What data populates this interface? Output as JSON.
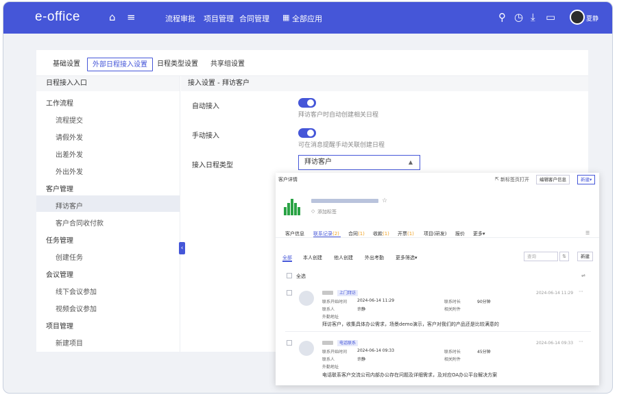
{
  "app": {
    "logo": "e-office",
    "nav": [
      "流程审批",
      "项目管理",
      "合同管理"
    ],
    "all_apps": "全部应用",
    "user": "夏静"
  },
  "tabs": [
    "基础设置",
    "外部日程接入设置",
    "日程类型设置",
    "共享组设置"
  ],
  "left_panel": {
    "header": "日程接入入口",
    "groups": [
      {
        "title": "工作流程",
        "items": [
          "流程提交",
          "请假外发",
          "出差外发",
          "外出外发"
        ]
      },
      {
        "title": "客户管理",
        "items": [
          "拜访客户",
          "客户合同收付款"
        ]
      },
      {
        "title": "任务管理",
        "items": [
          "创建任务"
        ]
      },
      {
        "title": "会议管理",
        "items": [
          "线下会议参加",
          "视频会议参加"
        ]
      },
      {
        "title": "项目管理",
        "items": [
          "新建项目"
        ]
      }
    ]
  },
  "settings": {
    "header": "接入设置 - 拜访客户",
    "auto_label": "自动接入",
    "auto_desc": "拜访客户时自动创建相关日程",
    "manual_label": "手动接入",
    "manual_desc": "可在消息提醒手动关联创建日程",
    "type_label": "接入日程类型",
    "type_value": "拜访客户"
  },
  "popup": {
    "title": "客户详情",
    "open_new_tab": "新标签页打开",
    "edit_btn": "编辑客户信息",
    "new_btn": "新建",
    "add_tag": "添加标签",
    "tabs": [
      "客户信息",
      "联系记录",
      "合同",
      "收款",
      "开票",
      "项目(研发)",
      "报价",
      "更多"
    ],
    "tab_counts": {
      "contact": "(2)",
      "contract": "(1)",
      "receipt": "(1)",
      "invoice": "(1)"
    },
    "subtabs": [
      "全部",
      "本人创建",
      "他人创建",
      "外出考勤",
      "更多筛选"
    ],
    "search_placeholder": "查询",
    "new_record": "新建",
    "select_all": "全选",
    "records": [
      {
        "tag": "上门拜访",
        "start_label": "联系开始时间",
        "start_value": "2024-06-14 11:29",
        "person_label": "联系人",
        "person_value": "许静",
        "addr_label": "外勤地址",
        "dur_label": "联系时长",
        "dur_value": "90分钟",
        "attach_label": "相关附件",
        "content": "拜访客户，收集具体办公需求，场景demo演示，客户对我们的产品还是比较满意的",
        "time": "2024-06-14 11:29"
      },
      {
        "tag": "电话联系",
        "start_label": "联系开始时间",
        "start_value": "2024-06-14 09:33",
        "person_label": "联系人",
        "person_value": "许静",
        "addr_label": "外勤地址",
        "dur_label": "联系时长",
        "dur_value": "45分钟",
        "attach_label": "相关附件",
        "content": "电话联系客户交流公司内部办公存在问题及详细需求，及对应OA办公平台解决方案",
        "time": "2024-06-14 09:33"
      }
    ]
  },
  "colors": {
    "primary": "#4556d8",
    "accent_green": "#2aa345",
    "background": "#f0f2f6"
  }
}
